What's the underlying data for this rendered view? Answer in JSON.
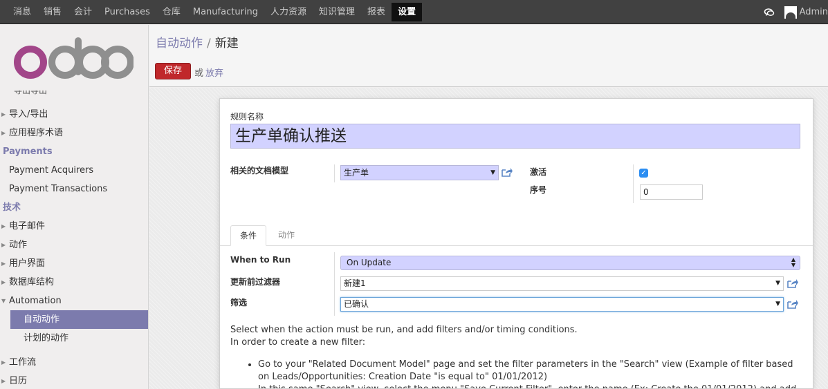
{
  "topbar": {
    "menu": [
      "消息",
      "销售",
      "会计",
      "Purchases",
      "仓库",
      "Manufacturing",
      "人力资源",
      "知识管理",
      "报表",
      "设置"
    ],
    "active": "设置",
    "user": "Admin"
  },
  "sidebar": {
    "logo_text": "odoo",
    "clipped_item": "导出导出",
    "items_top": [
      "导入/导出",
      "应用程序术语"
    ],
    "section_payments": "Payments",
    "payments_items": [
      "Payment Acquirers",
      "Payment Transactions"
    ],
    "section_tech": "技术",
    "tech_items": [
      "电子邮件",
      "动作",
      "用户界面",
      "数据库结构",
      "Automation"
    ],
    "automation_items": [
      "自动动作",
      "计划的动作"
    ],
    "items_bottom": [
      "工作流",
      "日历"
    ]
  },
  "header": {
    "breadcrumb_parent": "自动动作",
    "breadcrumb_sep": "/",
    "breadcrumb_current": "新建",
    "save_label": "保存",
    "or_text": "或",
    "discard_label": "放弃"
  },
  "form": {
    "rule_name_label": "规则名称",
    "rule_name_value": "生产单确认推送",
    "model_label": "相关的文档模型",
    "model_value": "生产单",
    "active_label": "激活",
    "active_checked": true,
    "sequence_label": "序号",
    "sequence_value": "0",
    "tabs": [
      "条件",
      "动作"
    ],
    "when_label": "When to Run",
    "when_value": "On Update",
    "pre_filter_label": "更新前过滤器",
    "pre_filter_value": "新建1",
    "filter_label": "筛选",
    "filter_value": "已确认",
    "help_line1": "Select when the action must be run, and add filters and/or timing conditions.",
    "help_line2": "In order to create a new filter:",
    "help_bullets": [
      "Go to your \"Related Document Model\" page and set the filter parameters in the \"Search\" view (Example of filter based on Leads/Opportunities: Creation Date \"is equal to\" 01/01/2012)",
      "In this same \"Search\" view, select the menu \"Save Current Filter\", enter the name (Ex: Create the 01/01/2012) and add the option \"Share with all users\""
    ]
  },
  "colors": {
    "topbar_bg": "#414141",
    "accent": "#7c7bad",
    "save_button": "#c0282b",
    "required_field": "#d2d2ff"
  }
}
